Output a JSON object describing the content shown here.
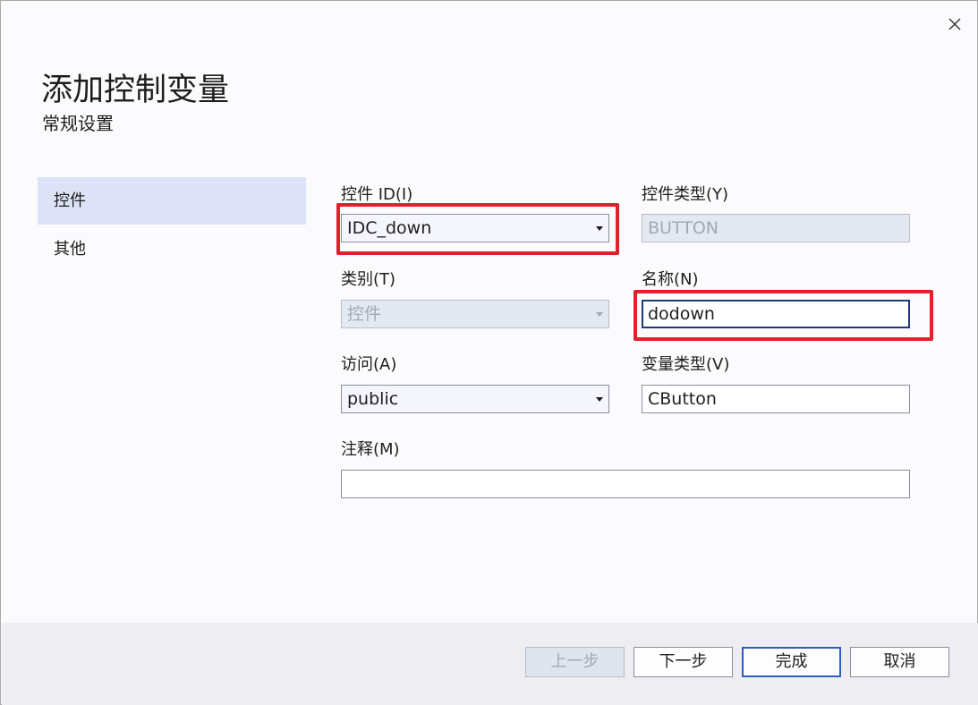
{
  "dialog": {
    "title": "添加控制变量",
    "subtitle": "常规设置"
  },
  "nav": {
    "items": [
      {
        "label": "控件",
        "selected": true
      },
      {
        "label": "其他",
        "selected": false
      }
    ]
  },
  "form": {
    "control_id": {
      "label": "控件 ID(I)",
      "value": "IDC_down"
    },
    "control_type": {
      "label": "控件类型(Y)",
      "value": "BUTTON"
    },
    "category": {
      "label": "类别(T)",
      "value": "控件"
    },
    "name": {
      "label": "名称(N)",
      "value": "dodown"
    },
    "access": {
      "label": "访问(A)",
      "value": "public"
    },
    "variable_type": {
      "label": "变量类型(V)",
      "value": "CButton"
    },
    "comment": {
      "label": "注释(M)",
      "value": ""
    }
  },
  "buttons": {
    "back": "上一步",
    "next": "下一步",
    "finish": "完成",
    "cancel": "取消"
  },
  "colors": {
    "highlight": "#e0202a",
    "nav_selected": "#dde2f6",
    "primary_border": "#2a5ec0"
  }
}
